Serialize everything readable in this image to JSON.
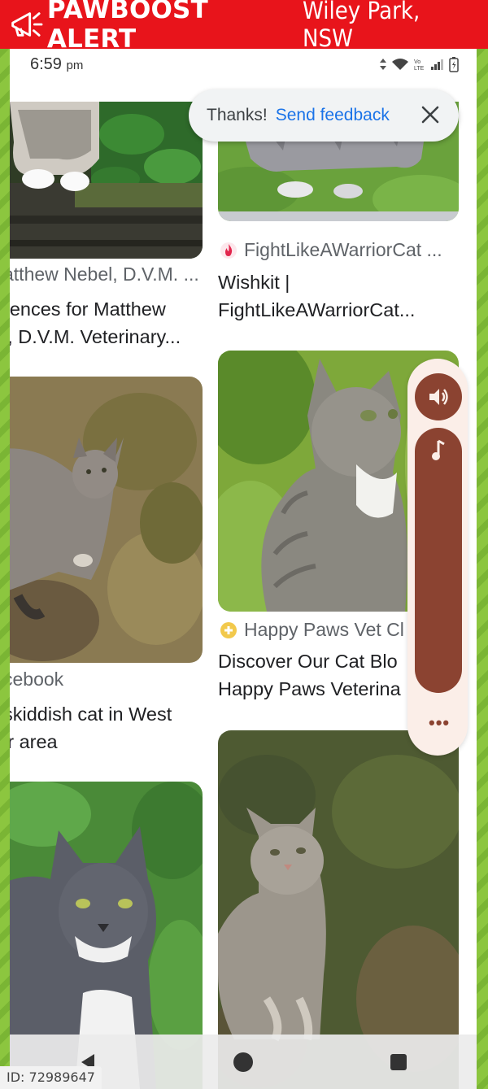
{
  "banner": {
    "brand": "PAWBOOST ALERT",
    "location": "Wiley Park, NSW",
    "bg_color": "#e8141b"
  },
  "status_bar": {
    "time": "6:59",
    "ampm": "pm"
  },
  "feedback": {
    "thanks": "Thanks!",
    "send_feedback": "Send feedback"
  },
  "left_column": [
    {
      "source": "atthew Nebel, D.V.M. ...",
      "title_line1": "rences for Matthew",
      "title_line2": "l, D.V.M. Veterinary..."
    },
    {
      "source": "cebook",
      "title_line1": "skiddish cat in West",
      "title_line2": "ir area"
    }
  ],
  "right_column": [
    {
      "source": "FightLikeAWarriorCat ...",
      "source_icon": "flame-icon",
      "title_line1": "Wishkit |",
      "title_line2": "FightLikeAWarriorCat..."
    },
    {
      "source": "Happy Paws Vet Cl",
      "source_icon": "plus-badge-icon",
      "title_line1": "Discover Our Cat Blo",
      "title_line2": "Happy Paws Veterina"
    }
  ],
  "volume_panel": {
    "accent": "#8b4331",
    "more": "•••"
  },
  "id_tag": "ID: 72989647"
}
